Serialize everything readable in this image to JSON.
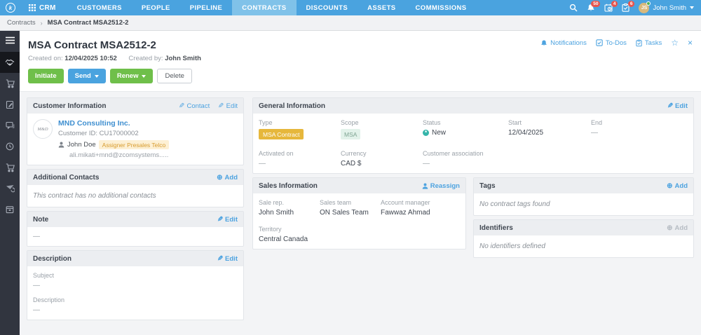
{
  "topnav": {
    "logo": "k",
    "app_name": "CRM",
    "items": [
      {
        "label": "CUSTOMERS",
        "active": false
      },
      {
        "label": "PEOPLE",
        "active": false
      },
      {
        "label": "PIPELINE",
        "active": false
      },
      {
        "label": "CONTRACTS",
        "active": true
      },
      {
        "label": "DISCOUNTS",
        "active": false
      },
      {
        "label": "ASSETS",
        "active": false
      },
      {
        "label": "COMMISSIONS",
        "active": false
      }
    ],
    "badges": {
      "notifications": "50",
      "calendar": "4",
      "tasks": "6"
    },
    "user": {
      "initials": "JS",
      "name": "John Smith"
    }
  },
  "breadcrumb": {
    "root": "Contracts",
    "separator": "›",
    "current": "MSA Contract MSA2512-2"
  },
  "page": {
    "title": "MSA Contract MSA2512-2",
    "created_on_label": "Created on:",
    "created_on": "12/04/2025 10:52",
    "created_by_label": "Created by:",
    "created_by": "John Smith",
    "actions": {
      "initiate": "Initiate",
      "send": "Send",
      "renew": "Renew",
      "delete": "Delete"
    },
    "header_links": {
      "notifications": "Notifications",
      "todos": "To-Dos",
      "tasks": "Tasks",
      "star": "☆",
      "close": "×"
    }
  },
  "customer_info": {
    "title": "Customer Information",
    "contact_link": "Contact",
    "edit_link": "Edit",
    "logo_text": "M&D",
    "name": "MND Consulting Inc.",
    "customer_id_label": "Customer ID:",
    "customer_id": "CU17000002",
    "contact_name": "John Doe",
    "contact_badge": "Assigner Presales Telco",
    "contact_email": "ali.mikati+mnd@zcomsystems....."
  },
  "additional_contacts": {
    "title": "Additional Contacts",
    "add_link": "Add",
    "empty": "This contract has no additional contacts"
  },
  "note": {
    "title": "Note",
    "edit_link": "Edit",
    "value": "—"
  },
  "description": {
    "title": "Description",
    "edit_link": "Edit",
    "subject_label": "Subject",
    "subject_value": "—",
    "description_label": "Description",
    "description_value": "—"
  },
  "general_info": {
    "title": "General Information",
    "edit_link": "Edit",
    "type_label": "Type",
    "type_value": "MSA Contract",
    "scope_label": "Scope",
    "scope_value": "MSA",
    "status_label": "Status",
    "status_value": "New",
    "status_glyph": "*",
    "start_label": "Start",
    "start_value": "12/04/2025",
    "end_label": "End",
    "end_value": "—",
    "activated_label": "Activated on",
    "activated_value": "—",
    "currency_label": "Currency",
    "currency_value": "CAD $",
    "assoc_label": "Customer association",
    "assoc_value": "—"
  },
  "sales_info": {
    "title": "Sales Information",
    "reassign_link": "Reassign",
    "sale_rep_label": "Sale rep.",
    "sale_rep": "John Smith",
    "sales_team_label": "Sales team",
    "sales_team": "ON Sales Team",
    "account_manager_label": "Account manager",
    "account_manager": "Fawwaz Ahmad",
    "territory_label": "Territory",
    "territory": "Central Canada"
  },
  "tags": {
    "title": "Tags",
    "add_link": "Add",
    "empty": "No contract tags found"
  },
  "identifiers": {
    "title": "Identifiers",
    "add_link": "Add",
    "empty": "No identifiers defined"
  },
  "colors": {
    "nav_blue": "#4aa3df",
    "nav_active": "#80c2e9",
    "sidebar": "#31353f",
    "link_blue": "#4da3e0",
    "green": "#6fbf4a",
    "gold_badge": "#e6b73c",
    "mint_badge_bg": "#e2f2ea",
    "teal_status": "#35b5aa",
    "red_badge": "#e8554d",
    "avatar_gold": "#d9b97c"
  }
}
